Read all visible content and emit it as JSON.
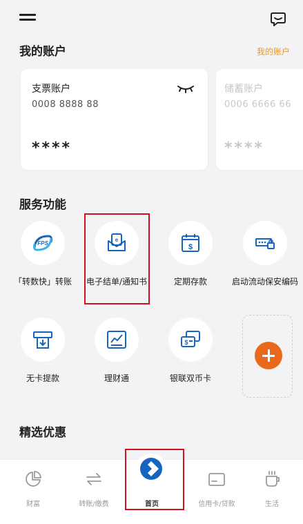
{
  "header": {
    "menu_icon": "hamburger-menu-icon",
    "chat_icon": "chat-bubble-icon"
  },
  "accounts": {
    "title": "我的账户",
    "link": "我的账户",
    "cards": [
      {
        "name": "支票账户",
        "number": "0008 8888 88",
        "balance": "****"
      },
      {
        "name": "储蓄账户",
        "number": "0006 6666 66",
        "balance": "****"
      }
    ]
  },
  "services": {
    "title": "服务功能",
    "items": [
      {
        "label": "「转数快」转账",
        "icon": "fps-icon"
      },
      {
        "label": "电子结单/通知书",
        "icon": "e-statement-icon"
      },
      {
        "label": "定期存款",
        "icon": "time-deposit-icon"
      },
      {
        "label": "启动流动保安编码",
        "icon": "security-code-icon"
      },
      {
        "label": "无卡提款",
        "icon": "cardless-withdrawal-icon"
      },
      {
        "label": "理财通",
        "icon": "wealth-connect-icon"
      },
      {
        "label": "银联双币卡",
        "icon": "unionpay-card-icon"
      }
    ],
    "add_icon": "plus-icon"
  },
  "promotions": {
    "title": "精选优惠"
  },
  "nav": {
    "items": [
      {
        "label": "财富",
        "icon": "pie-chart-icon"
      },
      {
        "label": "转账/缴费",
        "icon": "transfer-arrows-icon"
      },
      {
        "label": "首页",
        "icon": "bank-logo-icon"
      },
      {
        "label": "信用卡/贷款",
        "icon": "credit-card-icon"
      },
      {
        "label": "生活",
        "icon": "cup-icon"
      }
    ]
  },
  "colors": {
    "accent": "#e9691c",
    "link": "#e89a2c",
    "brand_blue": "#1565c0",
    "highlight": "#d3101c"
  }
}
